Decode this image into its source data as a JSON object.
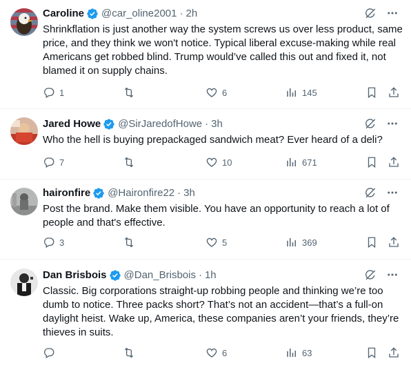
{
  "tweets": [
    {
      "name": "Caroline",
      "handle": "@car_oline2001",
      "time": "2h",
      "text": "Shrinkflation is just another way the system screws us over less product, same price, and they think we won't notice. Typical liberal excuse-making while real Americans get robbed blind. Trump would’ve called this out and fixed it, not blamed it on supply chains.",
      "replies": "1",
      "retweets": "",
      "likes": "6",
      "views": "145"
    },
    {
      "name": "Jared Howe",
      "handle": "@SirJaredofHowe",
      "time": "3h",
      "text": "Who the hell is buying prepackaged sandwich meat? Ever heard of a deli?",
      "replies": "7",
      "retweets": "",
      "likes": "10",
      "views": "671"
    },
    {
      "name": "haironfire",
      "handle": "@Haironfire22",
      "time": "3h",
      "text": "Post the brand. Make them visible. You have an opportunity to reach a lot of people and that's effective.",
      "replies": "3",
      "retweets": "",
      "likes": "5",
      "views": "369"
    },
    {
      "name": "Dan Brisbois",
      "handle": "@Dan_Brisbois",
      "time": "1h",
      "text": "Classic. Big corporations straight-up robbing people and thinking we’re too dumb to notice. Three packs short? That’s not an accident—that’s a full-on daylight heist. Wake up, America, these companies aren’t your friends, they’re thieves in suits.",
      "replies": "",
      "retweets": "",
      "likes": "6",
      "views": "63"
    }
  ],
  "separator": "·",
  "icons": {
    "verified": "verified-badge-icon",
    "grok": "grok-icon",
    "more": "more-icon",
    "reply": "reply-icon",
    "retweet": "retweet-icon",
    "like": "like-icon",
    "views": "views-icon",
    "bookmark": "bookmark-icon",
    "share": "share-icon"
  },
  "colors": {
    "verified": "#1d9bf0",
    "text": "#0f1419",
    "secondary": "#536471",
    "border": "#eff3f4"
  }
}
